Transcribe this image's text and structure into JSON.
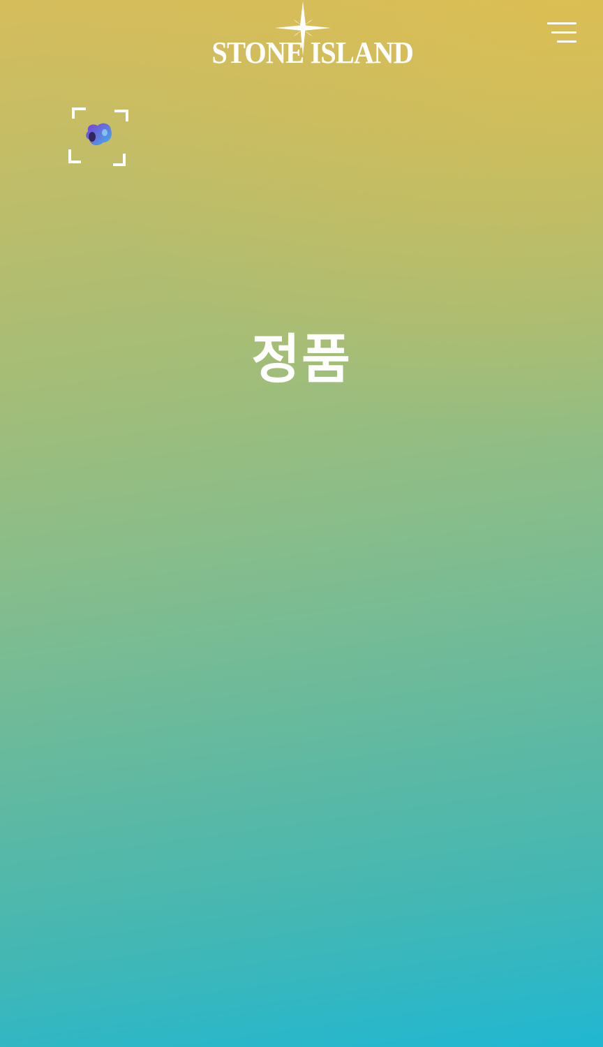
{
  "header": {
    "brand_name": "STONE ISLAND",
    "logo_icon": "compass-rose-icon",
    "menu_icon": "hamburger-menu-icon"
  },
  "scan": {
    "icon": "camera-scan-icon"
  },
  "hero": {
    "title": "정품"
  },
  "colors": {
    "top_gradient": "#d6bd5c",
    "middle_gradient": "#86bd8c",
    "bottom_gradient": "#20b7d2",
    "accent_yellow": "#e8be48",
    "text": "#ffffff"
  }
}
